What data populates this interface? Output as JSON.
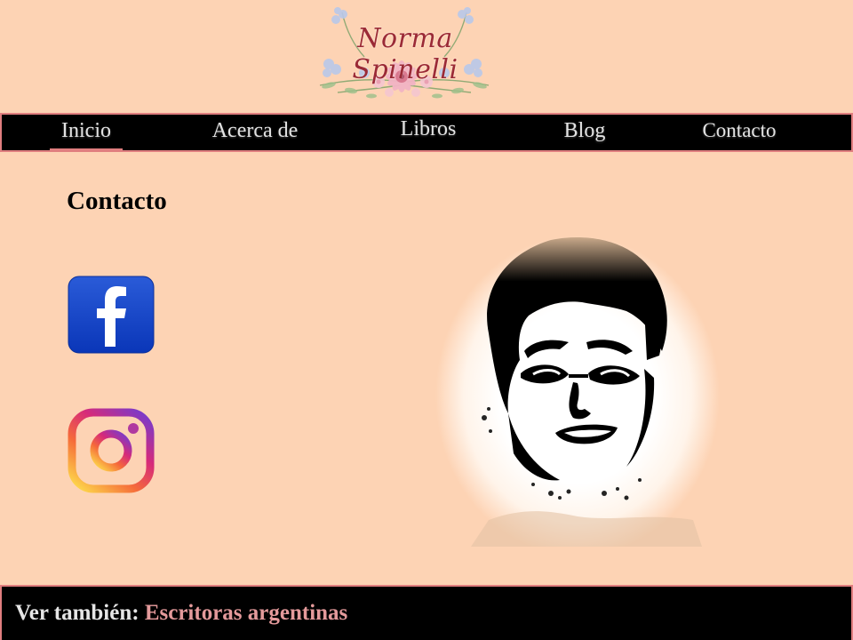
{
  "header": {
    "logo_text": "Norma Spinelli"
  },
  "nav": {
    "items": [
      {
        "label": "Inicio",
        "active": true
      },
      {
        "label": "Acerca de",
        "active": false
      },
      {
        "label": "Libros",
        "active": false
      },
      {
        "label": "Blog",
        "active": false
      },
      {
        "label": "Contacto",
        "active": false
      }
    ]
  },
  "main": {
    "title": "Contacto",
    "social": [
      {
        "icon": "facebook-icon"
      },
      {
        "icon": "instagram-icon"
      }
    ],
    "portrait_icon": "portrait-photo"
  },
  "footer": {
    "prefix": "Ver también:",
    "link": "Escritoras argentinas"
  },
  "colors": {
    "background": "#fdd3b4",
    "bar": "#000000",
    "accent": "#e07e7f",
    "link": "#e49a9b",
    "logo": "#9b2a36"
  }
}
